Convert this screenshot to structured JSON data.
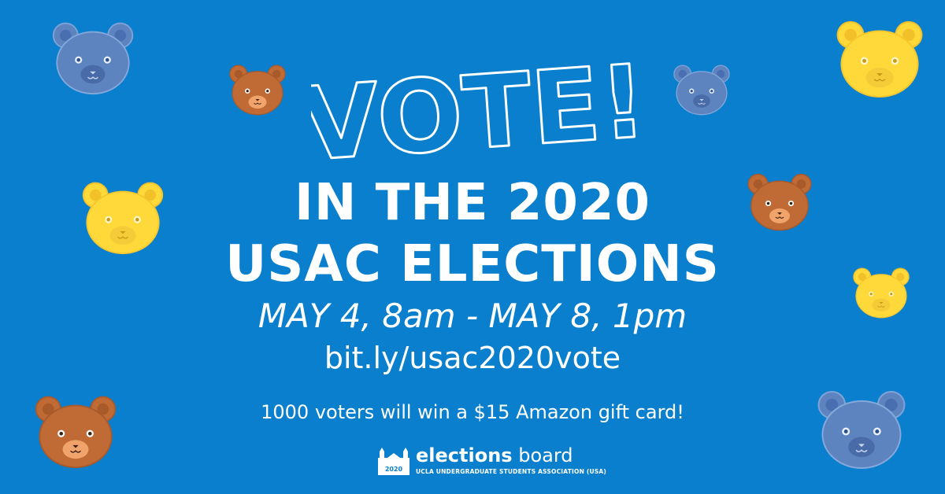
{
  "colors": {
    "background": "#0a7fcd",
    "bear_blue": "#5e84c0",
    "bear_brown": "#c06a35",
    "bear_yellow": "#ffd83a",
    "text": "#ffffff"
  },
  "vote_word": "VOTE!",
  "headline": {
    "line1": "IN THE 2020",
    "line2": "USAC ELECTIONS"
  },
  "dates": "MAY 4, 8am - MAY 8, 1pm",
  "link": "bit.ly/usac2020vote",
  "prize": "1000 voters will win a $15 Amazon gift card!",
  "logo": {
    "title_bold": "elections",
    "title_rest": " board",
    "subtitle": "UCLA UNDERGRADUATE STUDENTS ASSOCIATION (USA)",
    "badge_year": "2020"
  }
}
